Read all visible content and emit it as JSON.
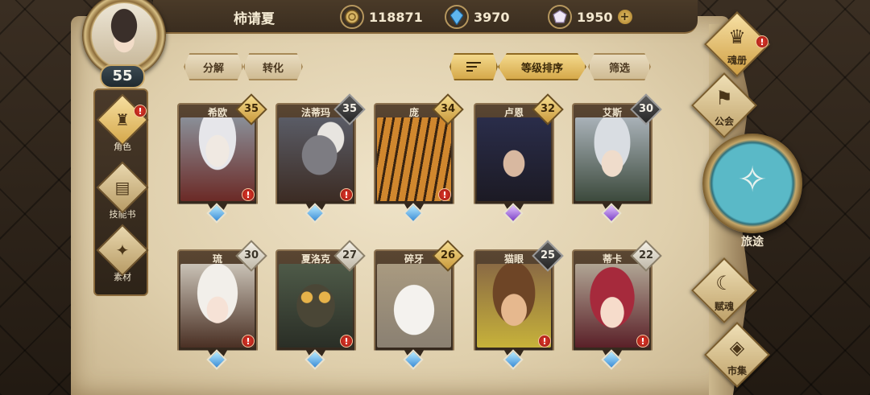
{
  "player": {
    "name": "柿请夏",
    "level": "55"
  },
  "currencies": [
    {
      "icon": "gold-coin-icon",
      "value": "118871"
    },
    {
      "icon": "blue-crystal-icon",
      "value": "3970"
    },
    {
      "icon": "prism-gem-icon",
      "value": "1950"
    }
  ],
  "left_nav": [
    {
      "label": "角色",
      "icon": "character-icon",
      "alert": "!"
    },
    {
      "label": "技能书",
      "icon": "skill-book-icon"
    },
    {
      "label": "素材",
      "icon": "material-icon"
    }
  ],
  "actions": {
    "decompose": "分解",
    "convert": "转化",
    "sort_level": "等级排序",
    "filter": "筛选"
  },
  "characters": [
    {
      "name": "希欧",
      "level": "35",
      "tier": "gold",
      "gem": "blue",
      "alert": "!"
    },
    {
      "name": "法蒂玛",
      "level": "35",
      "tier": "dark",
      "gem": "blue",
      "alert": "!"
    },
    {
      "name": "庞",
      "level": "34",
      "tier": "gold",
      "gem": "blue",
      "alert": "!"
    },
    {
      "name": "卢恩",
      "level": "32",
      "tier": "gold",
      "gem": "purple"
    },
    {
      "name": "艾斯",
      "level": "30",
      "tier": "dark",
      "gem": "purple"
    },
    {
      "name": "琉",
      "level": "30",
      "tier": "light",
      "gem": "blue",
      "alert": "!"
    },
    {
      "name": "夏洛克",
      "level": "27",
      "tier": "light",
      "gem": "blue",
      "alert": "!"
    },
    {
      "name": "碎牙",
      "level": "26",
      "tier": "gold",
      "gem": "blue"
    },
    {
      "name": "猫眼",
      "level": "25",
      "tier": "dark",
      "gem": "blue",
      "alert": "!"
    },
    {
      "name": "蒂卡",
      "level": "22",
      "tier": "light",
      "gem": "blue",
      "alert": "!"
    }
  ],
  "right_nav": {
    "soul_book": "魂册",
    "guild": "公会",
    "journey": "旅途",
    "soul_gift": "赋魂",
    "market": "市集",
    "alert": "!"
  },
  "colors": {
    "parchment": "#e6d7b6",
    "gold_accent": "#d6a94a",
    "alert_red": "#d8342a"
  }
}
